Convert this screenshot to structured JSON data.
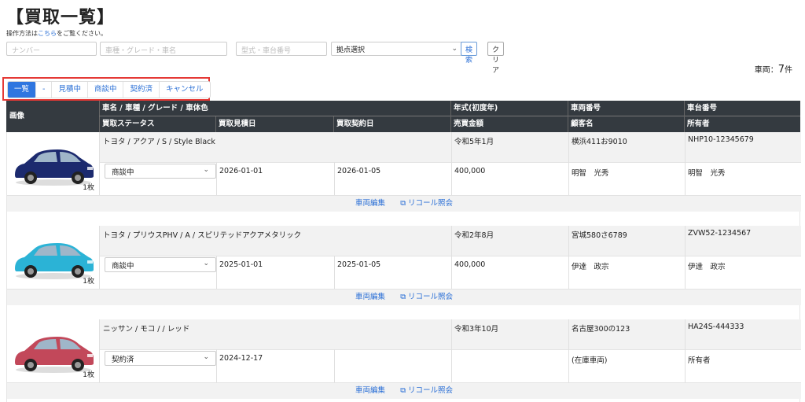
{
  "title": "【買取一覧】",
  "howto": {
    "pre": "操作方法は",
    "link": "こちら",
    "post": "をご覧ください。"
  },
  "filters": {
    "plate_placeholder": "ナンバー",
    "car_placeholder": "車種・グレード・車名",
    "model_placeholder": "型式・車台番号",
    "branch_value": "拠点選択",
    "search_label": "検索",
    "clear_label": "クリア"
  },
  "count": {
    "prefix": "車両：",
    "num": "7",
    "suffix": "件"
  },
  "tabs": [
    "一覧",
    "-",
    "見積中",
    "商談中",
    "契約済",
    "キャンセル"
  ],
  "headers": {
    "image": "画像",
    "name": "車名 / 車種 / グレード / 車体色",
    "year": "年式(初度年)",
    "plate": "車両番号",
    "chassis": "車台番号",
    "status": "買取ステータス",
    "estimate_date": "買取見積日",
    "contract_date": "買取契約日",
    "price": "売買金額",
    "customer": "顧客名",
    "owner": "所有者"
  },
  "actions": {
    "edit": "車両編集",
    "recall": "リコール照会"
  },
  "vehicles": [
    {
      "name": "トヨタ / アクア / S / Style Black",
      "year": "令和5年1月",
      "plate": "横浜411お9010",
      "chassis": "NHP10-12345679",
      "status": "商談中",
      "estimate_date": "2026-01-01",
      "contract_date": "2026-01-05",
      "price": "400,000",
      "customer": "明智　光秀",
      "owner": "明智　光秀",
      "image_count": "1枚",
      "color": "#1c2a6e"
    },
    {
      "name": "トヨタ / プリウスPHV / A / スピリテッドアクアメタリック",
      "year": "令和2年8月",
      "plate": "宮城580さ6789",
      "chassis": "ZVW52-1234567",
      "status": "商談中",
      "estimate_date": "2025-01-01",
      "contract_date": "2025-01-05",
      "price": "400,000",
      "customer": "伊達　政宗",
      "owner": "伊達　政宗",
      "image_count": "1枚",
      "color": "#2bb3d6"
    },
    {
      "name": "ニッサン / モコ / / レッド",
      "year": "令和3年10月",
      "plate": "名古屋300の123",
      "chassis": "HA24S-444333",
      "status": "契約済",
      "estimate_date": "2024-12-17",
      "contract_date": "",
      "price": "",
      "customer": "(在庫車両)",
      "owner": "所有者",
      "image_count": "1枚",
      "color": "#c2485a"
    }
  ]
}
